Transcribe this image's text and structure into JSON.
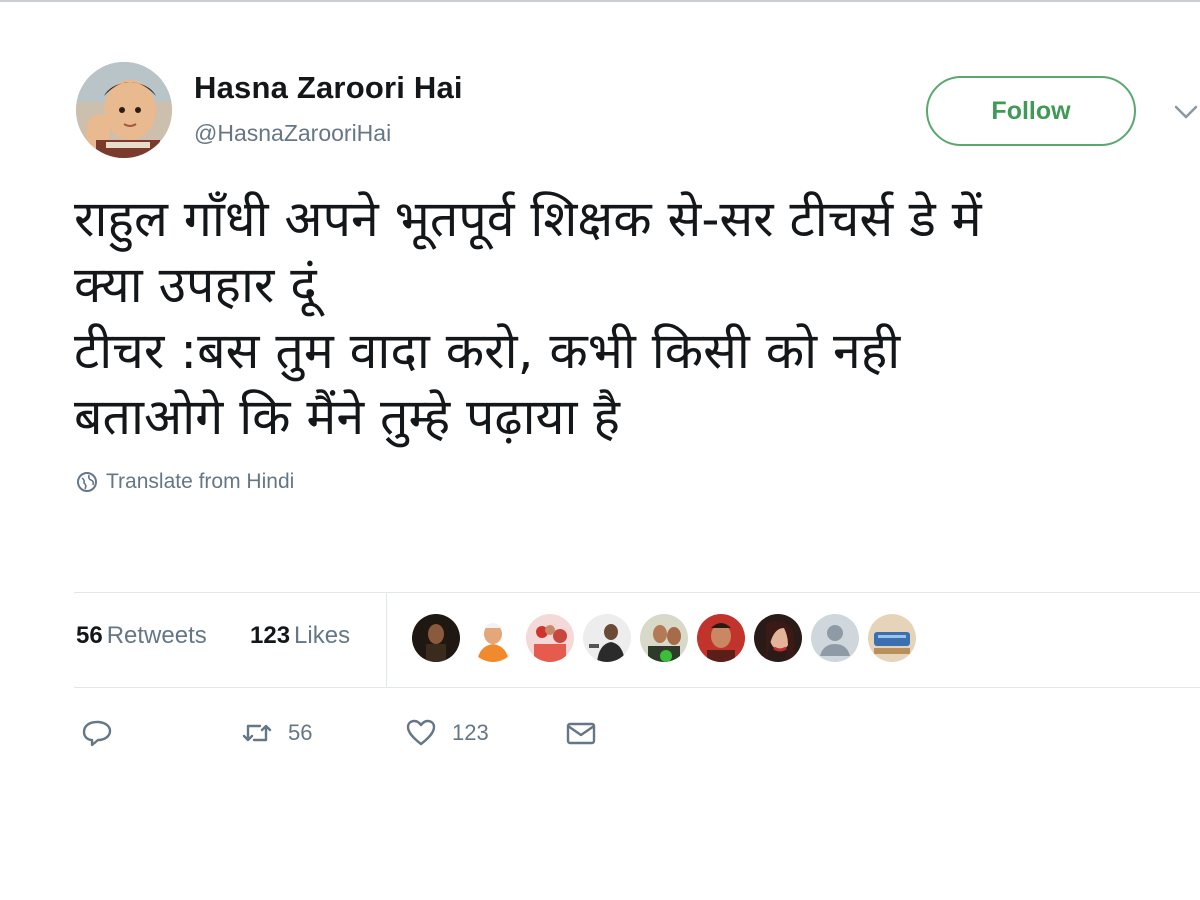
{
  "user": {
    "display_name": "Hasna Zaroori Hai",
    "handle": "@HasnaZarooriHai",
    "follow_label": "Follow"
  },
  "tweet": {
    "lines": [
      "राहुल गाँधी अपने भूतपूर्व शिक्षक से-सर टीचर्स डे में",
      "क्या उपहार दूं",
      "टीचर :बस तुम वादा करो, कभी किसी को नही",
      "बताओगे कि मैंने तुम्हे पढ़ाया है"
    ],
    "translate_label": "Translate from Hindi"
  },
  "stats": {
    "retweets_count": "56",
    "retweets_label": "Retweets",
    "likes_count": "123",
    "likes_label": "Likes"
  },
  "actions": {
    "retweet_count": "56",
    "like_count": "123"
  },
  "colors": {
    "follow_green": "#3f9a55",
    "muted_gray": "#657786",
    "text": "#14171a"
  },
  "icons": [
    "avatar",
    "chevron-down-icon",
    "globe-icon",
    "reply-icon",
    "retweet-icon",
    "heart-icon",
    "envelope-icon"
  ]
}
